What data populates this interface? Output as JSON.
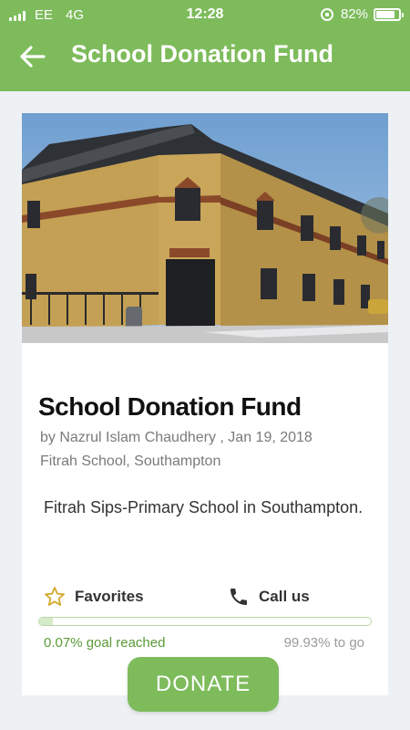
{
  "status_bar": {
    "carrier": "EE",
    "network": "4G",
    "time": "12:28",
    "battery": "82%",
    "battery_level": 0.82
  },
  "nav": {
    "title": "School Donation Fund",
    "back_icon": "arrow-left-icon"
  },
  "fund": {
    "image_alt": "School building photo",
    "title": "School Donation Fund",
    "byline": "by Nazrul Islam Chaudhery , Jan 19, 2018",
    "location": "Fitrah School, Southampton",
    "description": "Fitrah Sips-Primary School in Southampton."
  },
  "actions": {
    "favorites_label": "Favorites",
    "favorites_icon": "star-outline-icon",
    "call_label": "Call us",
    "call_icon": "phone-icon"
  },
  "progress": {
    "percent": 0.07,
    "reached_text": "0.07% goal reached",
    "remaining_text": "99.93% to go"
  },
  "donate": {
    "label": "DONATE"
  },
  "colors": {
    "brand_green": "#7dbb5b",
    "progress_text": "#5a9a37",
    "star_gold": "#d4a72c"
  }
}
